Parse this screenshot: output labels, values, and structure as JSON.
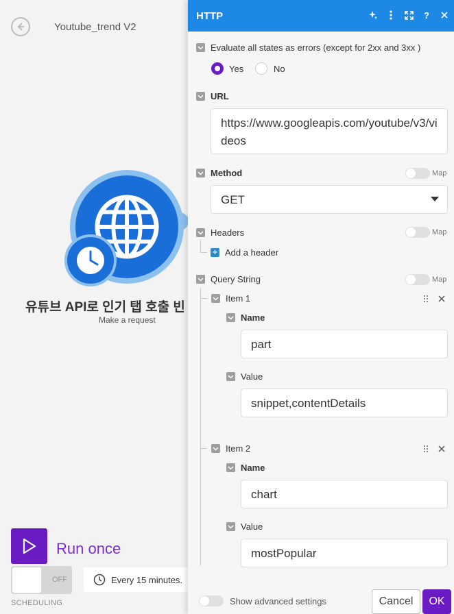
{
  "canvas": {
    "scenario_title": "Youtube_trend V2",
    "module_name": "유튜브 API로 인기 탭 호출 빈",
    "module_subtitle": "Make a request",
    "run_label": "Run once",
    "scheduling_state": "OFF",
    "scheduling_label": "SCHEDULING",
    "schedule_text": "Every 15 minutes."
  },
  "panel": {
    "title": "HTTP",
    "evaluate_label": "Evaluate all states as errors (except for 2xx and 3xx )",
    "evaluate_options": [
      "Yes",
      "No"
    ],
    "evaluate_selected": "Yes",
    "url_label": "URL",
    "url_value": "https://www.googleapis.com/youtube/v3/videos",
    "method_label": "Method",
    "method_value": "GET",
    "map_label": "Map",
    "headers_label": "Headers",
    "add_header_label": "Add a header",
    "query_label": "Query String",
    "items": [
      {
        "label": "Item 1",
        "name_label": "Name",
        "name_value": "part",
        "value_label": "Value",
        "value_value": "snippet,contentDetails"
      },
      {
        "label": "Item 2",
        "name_label": "Name",
        "name_value": "chart",
        "value_label": "Value",
        "value_value": "mostPopular"
      }
    ],
    "advanced_label": "Show advanced settings",
    "cancel_label": "Cancel",
    "ok_label": "OK"
  },
  "colors": {
    "header": "#1e88e5",
    "accent": "#6a1bc4",
    "module": "#1a6ed8"
  }
}
